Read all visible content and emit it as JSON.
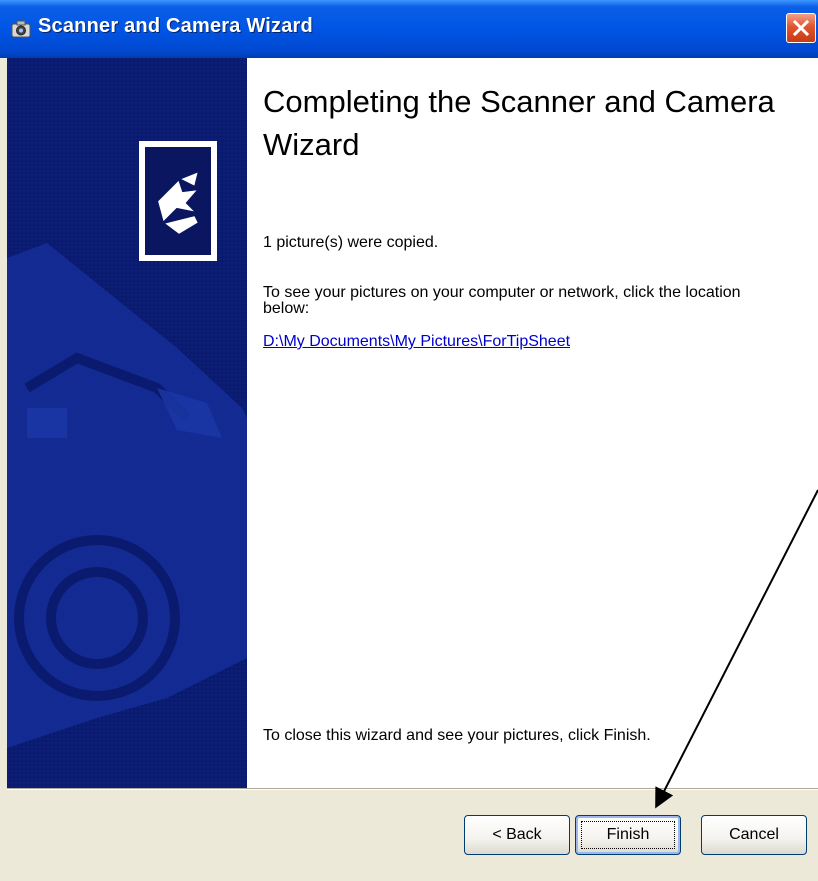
{
  "window": {
    "title": "Scanner and Camera Wizard",
    "title_icon": "camera-icon",
    "close_icon": "close-icon"
  },
  "sidebar": {
    "icon": "wizard-arrow-icon",
    "background_art": "camera-watermark"
  },
  "content": {
    "heading": "Completing the Scanner and Camera Wizard",
    "copied_text": "1 picture(s) were copied.",
    "location_text": "To see your pictures on your computer or network, click the location below:",
    "location_link": "D:\\My Documents\\My Pictures\\ForTipSheet",
    "finish_instruction": "To close this wizard and see your pictures, click Finish."
  },
  "buttons": {
    "back_label": "< Back",
    "finish_label": "Finish",
    "cancel_label": "Cancel"
  },
  "colors": {
    "titlebar": "#0055e5",
    "sidebar": "#0a1a6e",
    "link": "#0000cc",
    "close_button": "#e0562e"
  }
}
